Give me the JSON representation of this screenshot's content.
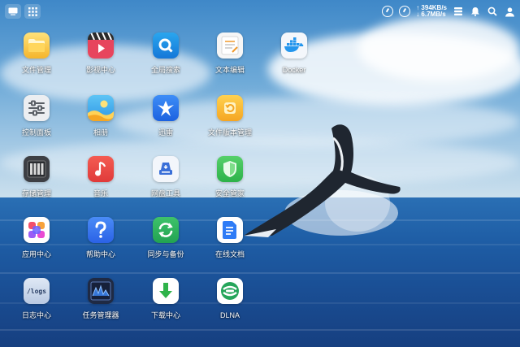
{
  "topbar": {
    "left_buttons": [
      "show-desktop-icon",
      "app-grid-icon"
    ],
    "upload_speed": "394KB/s",
    "download_speed": "6.7MB/s",
    "right_icons": [
      "cpu-gauge-icon",
      "ram-gauge-icon",
      "task-manager-icon",
      "bell-icon",
      "search-icon",
      "user-icon"
    ]
  },
  "apps": [
    {
      "label": "文件管理",
      "icon": "folder-icon"
    },
    {
      "label": "影视中心",
      "icon": "video-icon"
    },
    {
      "label": "全局搜索",
      "icon": "search-icon"
    },
    {
      "label": "文本编辑",
      "icon": "notepad-icon"
    },
    {
      "label": "Docker",
      "icon": "docker-icon"
    },
    {
      "label": "控制面板",
      "icon": "control-panel-icon"
    },
    {
      "label": "相册",
      "icon": "photos-icon"
    },
    {
      "label": "迅雷",
      "icon": "thunder-icon"
    },
    {
      "label": "文件版本管理",
      "icon": "file-version-icon"
    },
    {
      "label": "存储管理",
      "icon": "storage-icon"
    },
    {
      "label": "音乐",
      "icon": "music-icon"
    },
    {
      "label": "网盘工具",
      "icon": "cloud-drive-icon"
    },
    {
      "label": "安全管家",
      "icon": "shield-icon"
    },
    {
      "label": "应用中心",
      "icon": "app-center-icon"
    },
    {
      "label": "帮助中心",
      "icon": "help-icon"
    },
    {
      "label": "同步与备份",
      "icon": "sync-icon"
    },
    {
      "label": "在线文档",
      "icon": "document-icon"
    },
    {
      "label": "日志中心",
      "icon": "logs-icon"
    },
    {
      "label": "任务管理器",
      "icon": "task-manager-icon"
    },
    {
      "label": "下载中心",
      "icon": "download-icon"
    },
    {
      "label": "DLNA",
      "icon": "dlna-icon"
    }
  ],
  "logs_tile_text": "/logs"
}
